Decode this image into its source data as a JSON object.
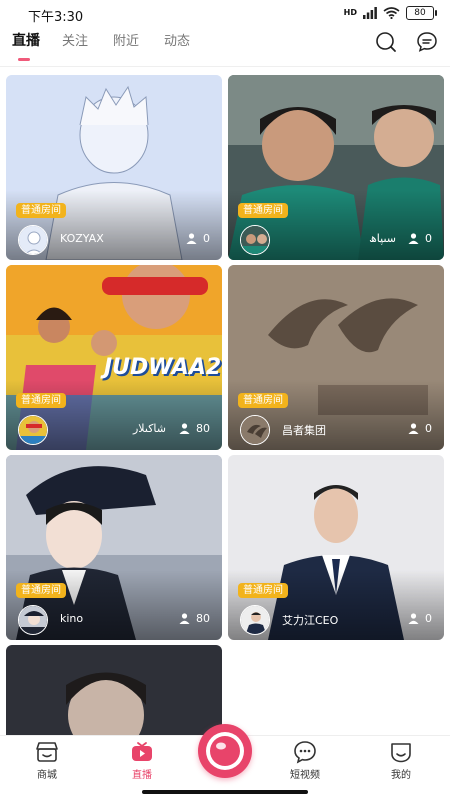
{
  "status": {
    "time": "下午3:30",
    "network": "HD",
    "battery": "80"
  },
  "tabs": [
    {
      "label": "直播",
      "active": true
    },
    {
      "label": "关注",
      "active": false
    },
    {
      "label": "附近",
      "active": false
    },
    {
      "label": "动态",
      "active": false
    }
  ],
  "header_icons": [
    "search-icon",
    "message-icon"
  ],
  "accent_color": "#e8446a",
  "badge_color": "#f2b31c",
  "rooms": [
    {
      "badge": "普通房间",
      "host": "KOZYAX",
      "viewers": "0"
    },
    {
      "badge": "普通房间",
      "host": "سىپاھ",
      "viewers": "0"
    },
    {
      "badge": "普通房间",
      "host": "شاكىلار",
      "viewers": "80",
      "poster_title": "JUDWAA2"
    },
    {
      "badge": "普通房间",
      "host": "昌者集团",
      "viewers": "0"
    },
    {
      "badge": "普通房间",
      "host": "kino",
      "viewers": "80"
    },
    {
      "badge": "普通房间",
      "host": "艾力江CEO",
      "viewers": "0"
    }
  ],
  "bottom_nav": [
    {
      "label": "商城",
      "icon": "shop-icon"
    },
    {
      "label": "直播",
      "icon": "live-icon",
      "active": true
    },
    {
      "label": "短视频",
      "icon": "short-video-icon"
    },
    {
      "label": "我的",
      "icon": "profile-icon"
    }
  ]
}
